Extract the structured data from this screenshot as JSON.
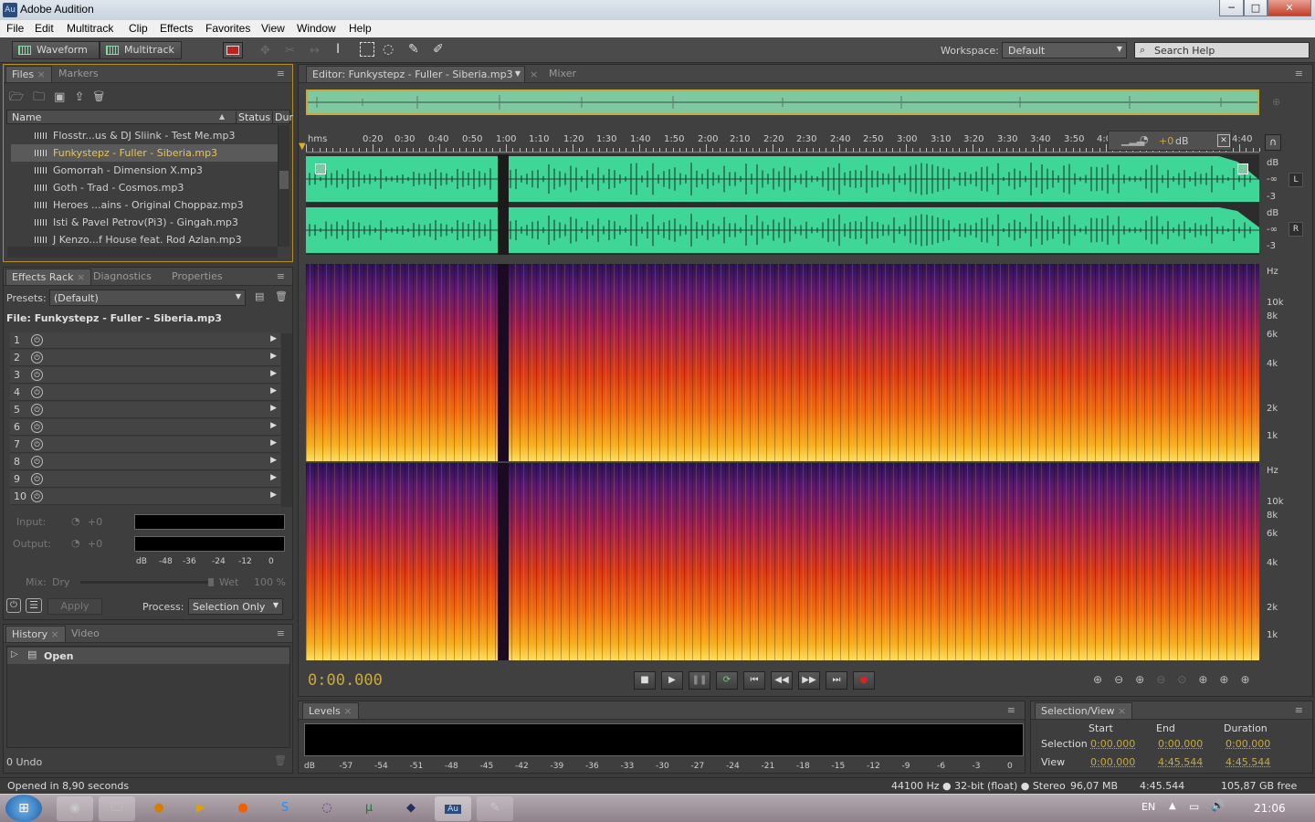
{
  "app": {
    "title": "Adobe Audition",
    "icon": "Au"
  },
  "window_buttons": {
    "minimize": "─",
    "maximize": "□",
    "close": "✕"
  },
  "menu": [
    "File",
    "Edit",
    "Multitrack",
    "Clip",
    "Effects",
    "Favorites",
    "View",
    "Window",
    "Help"
  ],
  "toolbar": {
    "waveform": "Waveform",
    "multitrack": "Multitrack",
    "workspace_label": "Workspace:",
    "workspace_value": "Default",
    "search_placeholder": "Search Help"
  },
  "files_panel": {
    "tabs": [
      "Files",
      "Markers"
    ],
    "columns": [
      "Name",
      "Status",
      "Dur"
    ],
    "files": [
      "Flosstr...us & DJ Sliink - Test Me.mp3",
      "Funkystepz - Fuller - Siberia.mp3",
      "Gomorrah - Dimension X.mp3",
      "Goth - Trad - Cosmos.mp3",
      "Heroes ...ains - Original Choppaz.mp3",
      "Isti & Pavel Petrov(Pi3) - Gingah.mp3",
      "J Kenzo...f House feat. Rod Azlan.mp3"
    ],
    "selected_index": 1
  },
  "effects_panel": {
    "tabs": [
      "Effects Rack",
      "Diagnostics",
      "Properties"
    ],
    "presets_label": "Presets:",
    "presets_value": "(Default)",
    "file_label": "File: Funkystepz - Fuller - Siberia.mp3",
    "slots": [
      "1",
      "2",
      "3",
      "4",
      "5",
      "6",
      "7",
      "8",
      "9",
      "10"
    ],
    "input_label": "Input:",
    "output_label": "Output:",
    "gain": "+0",
    "meter_scale": [
      "dB",
      "-48",
      "-36",
      "-24",
      "-12",
      "0"
    ],
    "mix_label": "Mix:",
    "dry": "Dry",
    "wet": "Wet",
    "wet_value": "100 %",
    "apply": "Apply",
    "process_label": "Process:",
    "process_value": "Selection Only"
  },
  "history_panel": {
    "tabs": [
      "History",
      "Video"
    ],
    "item": "Open",
    "undo": "0 Undo"
  },
  "editor": {
    "tab": "Editor: Funkystepz - Fuller - Siberia.mp3",
    "mixer_tab": "Mixer",
    "ruler": [
      "hms",
      "0:20",
      "0:30",
      "0:40",
      "0:50",
      "1:00",
      "1:10",
      "1:20",
      "1:30",
      "1:40",
      "1:50",
      "2:00",
      "2:10",
      "2:20",
      "2:30",
      "2:40",
      "2:50",
      "3:00",
      "3:10",
      "3:20",
      "3:30",
      "3:40",
      "3:50",
      "4:0",
      "4:40"
    ],
    "hud_gain": "+0",
    "hud_unit": "dB",
    "db_scale": [
      "dB",
      "-∞",
      "-3",
      "dB",
      "-∞",
      "-3"
    ],
    "channels": [
      "L",
      "R"
    ],
    "hz_scale": [
      "Hz",
      "10k",
      "8k",
      "6k",
      "4k",
      "2k",
      "1k"
    ],
    "time": "0:00.000"
  },
  "levels_panel": {
    "tab": "Levels",
    "scale": [
      "dB",
      "-57",
      "-54",
      "-51",
      "-48",
      "-45",
      "-42",
      "-39",
      "-36",
      "-33",
      "-30",
      "-27",
      "-24",
      "-21",
      "-18",
      "-15",
      "-12",
      "-9",
      "-6",
      "-3",
      "0"
    ]
  },
  "selection_panel": {
    "tab": "Selection/View",
    "headers": [
      "Start",
      "End",
      "Duration"
    ],
    "rows": [
      {
        "label": "Selection",
        "start": "0:00.000",
        "end": "0:00.000",
        "duration": "0:00.000"
      },
      {
        "label": "View",
        "start": "0:00.000",
        "end": "4:45.544",
        "duration": "4:45.544"
      }
    ]
  },
  "status_bar": {
    "message": "Opened in 8,90 seconds",
    "format": "44100 Hz ● 32-bit (float) ● Stereo",
    "size": "96,07 MB",
    "duration": "4:45.544",
    "free": "105,87 GB free"
  },
  "taskbar": {
    "lang": "EN",
    "clock": "21:06"
  }
}
